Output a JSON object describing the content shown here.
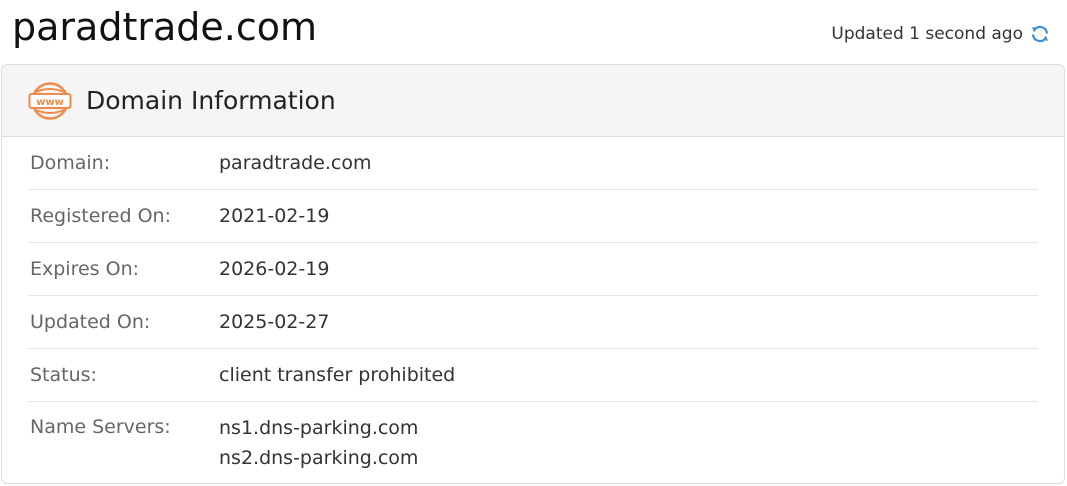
{
  "header": {
    "title": "paradtrade.com",
    "updated_text": "Updated 1 second ago",
    "refresh_icon": "refresh-icon",
    "refresh_color": "#3d8fd6"
  },
  "card": {
    "title": "Domain Information",
    "icon": "www-icon",
    "icon_color": "#f08a4b",
    "rows": [
      {
        "label": "Domain:",
        "value": "paradtrade.com"
      },
      {
        "label": "Registered On:",
        "value": "2021-02-19"
      },
      {
        "label": "Expires On:",
        "value": "2026-02-19"
      },
      {
        "label": "Updated On:",
        "value": "2025-02-27"
      },
      {
        "label": "Status:",
        "value": "client transfer prohibited"
      },
      {
        "label": "Name Servers:",
        "values": [
          "ns1.dns-parking.com",
          "ns2.dns-parking.com"
        ]
      }
    ]
  }
}
